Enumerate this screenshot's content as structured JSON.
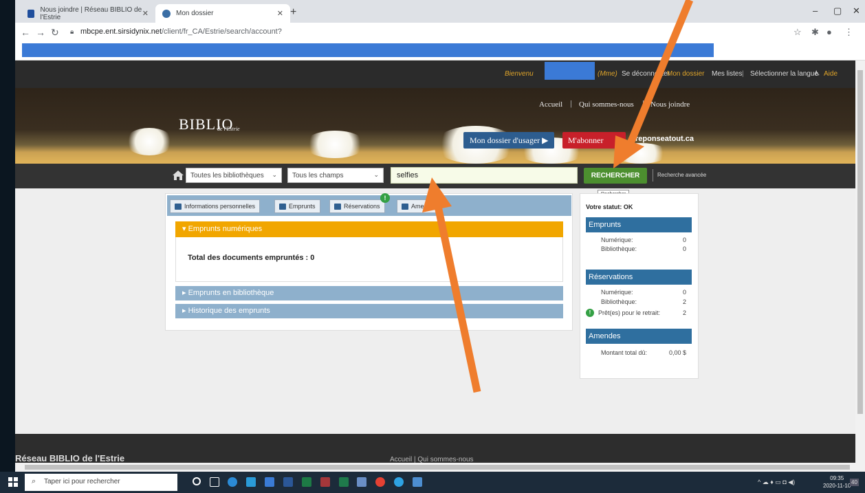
{
  "browser": {
    "tabs": [
      {
        "title": "Nous joindre | Réseau BIBLIO de l'Estrie",
        "close": "✕"
      },
      {
        "title": "Mon dossier",
        "close": "✕"
      }
    ],
    "new_tab": "+",
    "url_domain": "mbcpe.ent.sirsidynix.net",
    "url_path": "/client/fr_CA/Estrie/search/account?"
  },
  "userbar": {
    "greeting": "Bienvenu",
    "honorific": "(Mme)",
    "logout": "Se déconnecter",
    "my_account": "Mon dossier",
    "my_lists": "Mes listes",
    "select_language": "Sélectionner la langue",
    "help": "Aide"
  },
  "header": {
    "logo": "BIBLIO",
    "logo_sub": "de l'Estrie",
    "nav": [
      "Accueil",
      "Qui sommes-nous",
      "Nous joindre"
    ],
    "btn_dossier": "Mon dossier d'usager ▶",
    "btn_abonner": "M'abonner",
    "reponse": "reponseatout.ca"
  },
  "search": {
    "library_select": "Toutes les bibliothèques",
    "field_select": "Tous les champs",
    "query": "selfies",
    "button": "RECHERCHER",
    "advanced": "Recherche avancée",
    "tooltip": "Rechercher"
  },
  "account": {
    "tabs": [
      "Informations personnelles",
      "Emprunts",
      "Réservations",
      "Amendes"
    ],
    "reservations_badge": "!",
    "open_section": "Emprunts numériques",
    "total_label": "Total des documents empruntés : 0",
    "sections": [
      "Emprunts en bibliothèque",
      "Historique des emprunts"
    ]
  },
  "status": {
    "title": "Votre statut: OK",
    "emprunts": {
      "heading": "Emprunts",
      "rows": [
        {
          "label": "Numérique:",
          "value": "0"
        },
        {
          "label": "Bibliothèque:",
          "value": "0"
        }
      ]
    },
    "reservations": {
      "heading": "Réservations",
      "rows": [
        {
          "label": "Numérique:",
          "value": "0"
        },
        {
          "label": "Bibliothèque:",
          "value": "2"
        }
      ],
      "ready_label": "Prêt(es) pour le retrait:",
      "ready_value": "2"
    },
    "amendes": {
      "heading": "Amendes",
      "label": "Montant total dû:",
      "value": "0,00 $"
    }
  },
  "footer": {
    "title": "Réseau BIBLIO de l'Estrie",
    "sub": "Accueil | Qui sommes-nous"
  },
  "taskbar": {
    "search_placeholder": "Taper ici pour rechercher",
    "time": "09:35",
    "date": "2020-11-10",
    "notif_count": "40"
  },
  "colors": {
    "arrow": "#ef7d2d",
    "search_button": "#4c8f2f",
    "accordion_open": "#f1a600",
    "accordion": "#8eb0cc"
  }
}
